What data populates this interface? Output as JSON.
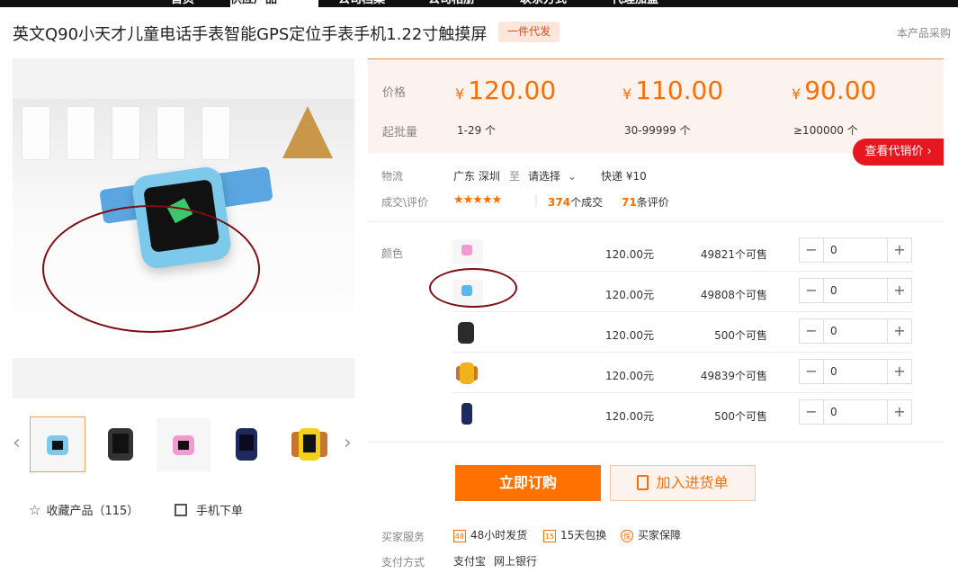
{
  "topnav": {
    "tabs": [
      "首页",
      "供应产品",
      "公司档案",
      "公司相册",
      "联系方式",
      "代理加盟"
    ],
    "active": 1
  },
  "product": {
    "title": "英文Q90小天才儿童电话手表智能GPS定位手表手机1.22寸触摸屏",
    "badge": "一件代发",
    "right_note": "本产品采购"
  },
  "gallery": {
    "prev_icon": "‹",
    "next_icon": "›"
  },
  "actions": {
    "favorite": "收藏产品（115）",
    "mobile_order": "手机下单"
  },
  "pricing": {
    "price_label": "价格",
    "batch_label": "起批量",
    "currency": "¥",
    "tiers": [
      {
        "price": "120.00",
        "qty": "1-29 个"
      },
      {
        "price": "110.00",
        "qty": "30-99999 个"
      },
      {
        "price": "90.00",
        "qty": "≥100000 个"
      }
    ],
    "deal_button": "查看代销价 ›"
  },
  "logistics": {
    "label": "物流",
    "from": "广东 深圳",
    "to_word": "至",
    "select": "请选择",
    "express": "快递 ¥10"
  },
  "reviews": {
    "label": "成交\\评价",
    "stars": "★★★★★",
    "deals_count": "374",
    "deals_word": "个成交",
    "review_count": "71",
    "review_word": "条评价"
  },
  "colors": {
    "label": "颜色",
    "rows": [
      {
        "price": "120.00元",
        "stock": "49821个可售",
        "qty": "0",
        "color": "#f29ad0"
      },
      {
        "price": "120.00元",
        "stock": "49808个可售",
        "qty": "0",
        "color": "#5bb6ea"
      },
      {
        "price": "120.00元",
        "stock": "500个可售",
        "qty": "0",
        "color": "#2b2b2b"
      },
      {
        "price": "120.00元",
        "stock": "49839个可售",
        "qty": "0",
        "color": "#f2b21a"
      },
      {
        "price": "120.00元",
        "stock": "500个可售",
        "qty": "0",
        "color": "#1c2a5e"
      }
    ],
    "minus": "−",
    "plus": "+"
  },
  "buttons": {
    "buy": "立即订购",
    "cart": "加入进货单"
  },
  "service": {
    "label": "买家服务",
    "items": [
      "48小时发货",
      "15天包换",
      "买家保障"
    ],
    "icons": [
      "48",
      "15",
      "保"
    ]
  },
  "payment": {
    "label": "支付方式",
    "methods": [
      "支付宝",
      "网上银行"
    ]
  }
}
